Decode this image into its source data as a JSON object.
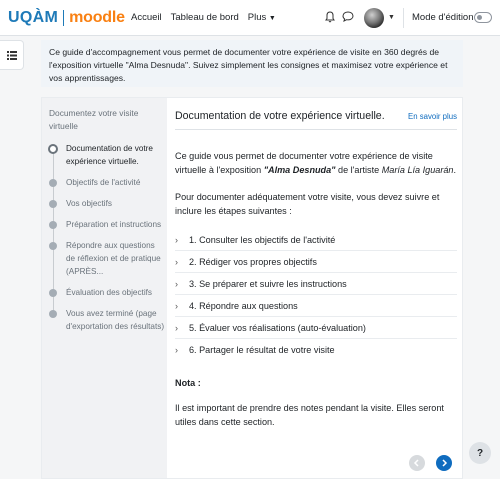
{
  "brand": {
    "uqam": "UQÀM",
    "moodle": "moodle"
  },
  "nav": {
    "links": [
      "Accueil",
      "Tableau de bord",
      "Plus"
    ],
    "edit_mode": "Mode d'édition"
  },
  "intro": "Ce guide d'accompagnement vous permet de documenter votre expérience de visite en 360 degrés de l'exposition virtuelle \"Alma Desnuda\". Suivez simplement les consignes et maximisez votre expérience et vos apprentissages.",
  "sidebar": {
    "title": "Documentez votre visite virtuelle",
    "steps": [
      "Documentation de votre expérience virtuelle.",
      "Objectifs de l'activité",
      "Vos objectifs",
      "Préparation et instructions",
      "Répondre aux questions de réflexion et de pratique (APRÈS...",
      "Évaluation des objectifs",
      "Vous avez terminé (page d'exportation des résultats)"
    ]
  },
  "content": {
    "title": "Documentation de votre expérience virtuelle.",
    "learn_more": "En savoir plus",
    "p1_a": "Ce guide vous permet de documenter votre expérience de visite virtuelle à l'exposition ",
    "p1_work": "\"Alma Desnuda\"",
    "p1_b": " de l'artiste ",
    "p1_artist": "María Lía Iguarán",
    "p1_c": ".",
    "p2": "Pour documenter adéquatement votre visite, vous devez suivre et inclure les étapes suivantes :",
    "items": [
      "1. Consulter les objectifs de l'activité",
      "2. Rédiger vos propres objectifs",
      "3. Se préparer et suivre les instructions",
      "4. Répondre aux questions",
      "5. Évaluer vos réalisations (auto-évaluation)",
      "6. Partager le résultat de votre visite"
    ],
    "nota": "Nota :",
    "p3": "Il est important de prendre des notes pendant la visite. Elles seront utiles dans cette section."
  },
  "help": "?",
  "colors": {
    "uqam_blue": "#1e7ab8",
    "moodle_orange": "#f98012",
    "primary": "#0f6cbf"
  },
  "icons": [
    "bell-icon",
    "chat-icon",
    "drawer-icon",
    "chevron-right-icon",
    "arrow-left-icon",
    "arrow-right-icon"
  ]
}
